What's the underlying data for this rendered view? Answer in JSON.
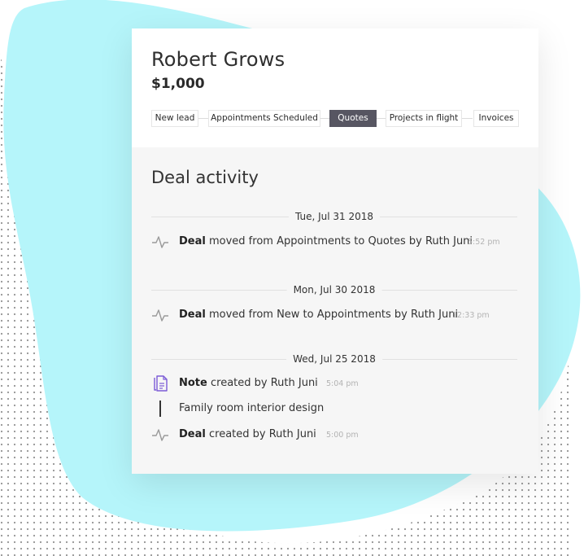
{
  "contact": {
    "name": "Robert Grows",
    "amount": "$1,000"
  },
  "pipeline": {
    "stages": [
      "New lead",
      "Appointments Scheduled",
      "Quotes",
      "Projects in flight",
      "Invoices"
    ],
    "active_stage": "Quotes"
  },
  "activity": {
    "title": "Deal activity",
    "groups": [
      {
        "date": "Tue, Jul 31 2018",
        "items": [
          {
            "subject": "Deal",
            "text": "moved from Appointments to Quotes by Ruth Juni",
            "time": "5:52 pm",
            "icon": "activity-pulse-icon"
          }
        ]
      },
      {
        "date": "Mon, Jul 30 2018",
        "items": [
          {
            "subject": "Deal",
            "text": "moved from New to Appointments by Ruth Juni",
            "time": "12:33 pm",
            "icon": "activity-pulse-icon"
          }
        ]
      },
      {
        "date": "Wed, Jul 25 2018",
        "items": [
          {
            "subject": "Note",
            "text": "created by Ruth Juni",
            "time": "5:04 pm",
            "icon": "note-document-icon",
            "body": "Family room interior design"
          },
          {
            "subject": "Deal",
            "text": "created by Ruth Juni",
            "time": "5:00 pm",
            "icon": "activity-pulse-icon"
          }
        ]
      }
    ]
  },
  "colors": {
    "blob": "#b5f5fa",
    "active_stage": "#575662",
    "note_icon": "#7b5bd6"
  }
}
